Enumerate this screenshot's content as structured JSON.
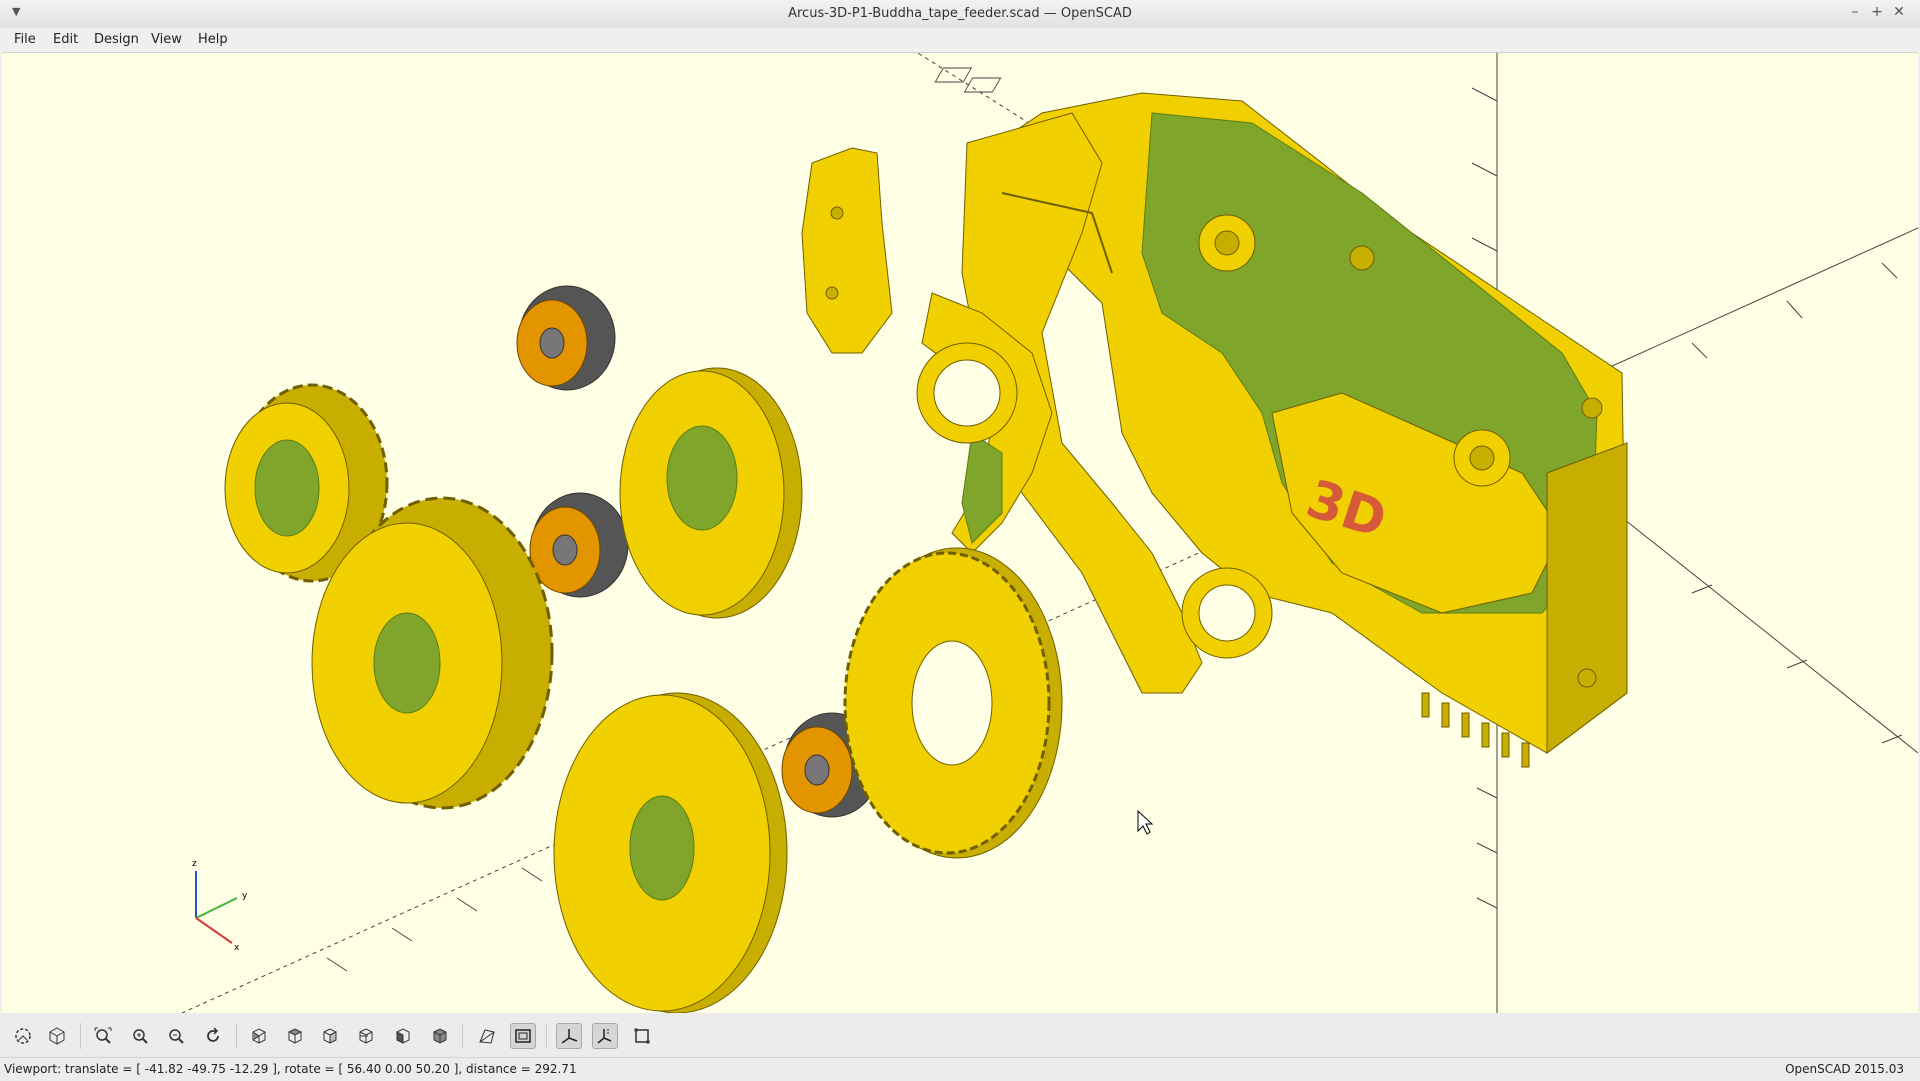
{
  "window": {
    "title": "Arcus-3D-P1-Buddha_tape_feeder.scad — OpenSCAD",
    "controls": [
      "–",
      "+",
      "✕"
    ]
  },
  "menu": [
    {
      "label": "File"
    },
    {
      "label": "Edit"
    },
    {
      "label": "Design"
    },
    {
      "label": "View"
    },
    {
      "label": "Help"
    }
  ],
  "viewport": {
    "background": "#ffffe5",
    "part_color": "#f0d000",
    "part_shade": "#c8ae00",
    "inner_color": "#7fa62a",
    "bearing_outer": "#555555",
    "bearing_inner": "#e39500",
    "emboss_color": "#d45a3a",
    "axes_labels": {
      "x": "x",
      "y": "y",
      "z": "z"
    }
  },
  "toolbar": {
    "buttons": [
      {
        "icon": "preview-icon"
      },
      {
        "icon": "render-icon"
      },
      {
        "icon": "view-all-icon"
      },
      {
        "icon": "zoom-in-icon"
      },
      {
        "icon": "zoom-out-icon"
      },
      {
        "icon": "reset-view-icon"
      },
      {
        "icon": "view-right-icon"
      },
      {
        "icon": "view-top-icon"
      },
      {
        "icon": "view-bottom-icon"
      },
      {
        "icon": "view-left-icon"
      },
      {
        "icon": "view-front-icon"
      },
      {
        "icon": "view-back-icon"
      },
      {
        "icon": "perspective-icon"
      },
      {
        "icon": "orthogonal-icon"
      },
      {
        "icon": "show-axes-icon"
      },
      {
        "icon": "show-scale-markers-icon"
      },
      {
        "icon": "show-edges-icon"
      }
    ]
  },
  "status": {
    "viewport": "Viewport: translate = [ -41.82 -49.75 -12.29 ], rotate = [ 56.40 0.00 50.20 ], distance = 292.71",
    "version": "OpenSCAD 2015.03"
  }
}
